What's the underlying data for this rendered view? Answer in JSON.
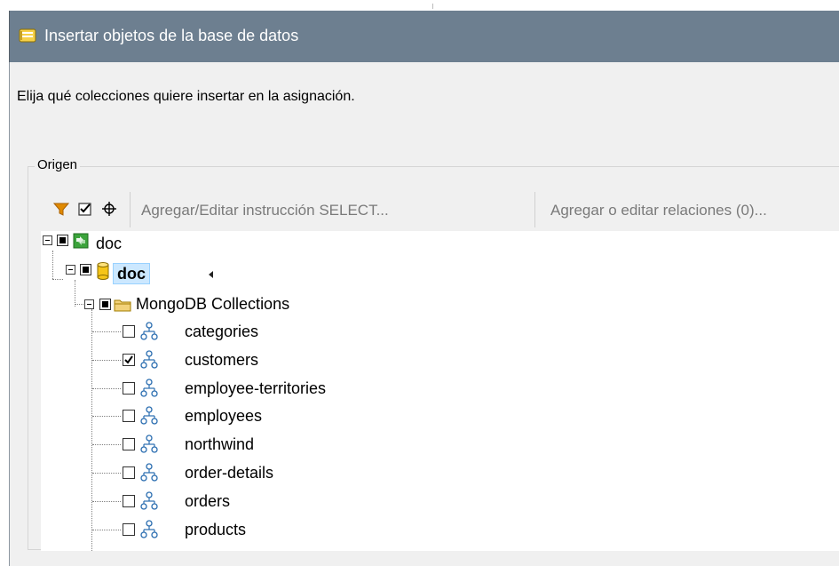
{
  "window": {
    "title": "Insertar objetos de la base de datos",
    "instruction": "Elija qué colecciones quiere insertar en la asignación."
  },
  "group": {
    "label": "Origen"
  },
  "toolbar": {
    "filter_icon": "filter-icon",
    "check_icon": "check-icon",
    "locate_icon": "crosshair-icon",
    "select_statement_label": "Agregar/Editar instrucción SELECT...",
    "relations_label": "Agregar o editar relaciones (0)..."
  },
  "tree": {
    "root": {
      "label": "doc",
      "icon": "connection-icon"
    },
    "database": {
      "label": "doc",
      "icon": "database-icon"
    },
    "folder": {
      "label": "MongoDB Collections",
      "icon": "folder-icon"
    },
    "collections": [
      {
        "label": "categories",
        "checked": false
      },
      {
        "label": "customers",
        "checked": true
      },
      {
        "label": "employee-territories",
        "checked": false
      },
      {
        "label": "employees",
        "checked": false
      },
      {
        "label": "northwind",
        "checked": false
      },
      {
        "label": "order-details",
        "checked": false
      },
      {
        "label": "orders",
        "checked": false
      },
      {
        "label": "products",
        "checked": false
      }
    ]
  },
  "colors": {
    "titlebar": "#6d7f90",
    "dialog_bg": "#f0f0f0",
    "selection_bg": "#cce8ff",
    "filter_orange": "#e08a00",
    "db_yellow": "#f5c518",
    "connection_green": "#3ba33b"
  }
}
